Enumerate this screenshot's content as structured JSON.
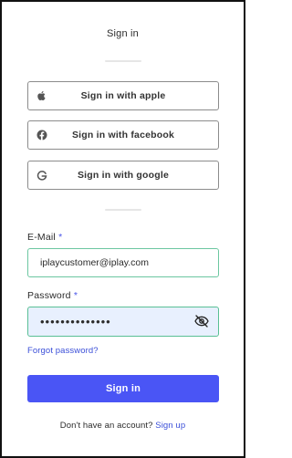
{
  "header": {
    "title": "Sign in"
  },
  "social": [
    {
      "label": "Sign in with apple",
      "icon": "apple-icon"
    },
    {
      "label": "Sign in with facebook",
      "icon": "facebook-icon"
    },
    {
      "label": "Sign in with google",
      "icon": "google-icon"
    }
  ],
  "form": {
    "email": {
      "label": "E-Mail",
      "required_marker": "*",
      "value": "iplaycustomer@iplay.com"
    },
    "password": {
      "label": "Password",
      "required_marker": "*",
      "value": "••••••••••••••",
      "toggle_icon": "eye-slash-icon"
    },
    "forgot_link": "Forgot password?",
    "submit_label": "Sign in"
  },
  "footer": {
    "prompt": "Don't have an account?",
    "signup_link": "Sign up"
  },
  "colors": {
    "primary": "#4a55f5",
    "link": "#3b4fd8",
    "input_focus_border": "#6cc7a1",
    "autofill_bg": "#e8f0fe"
  }
}
